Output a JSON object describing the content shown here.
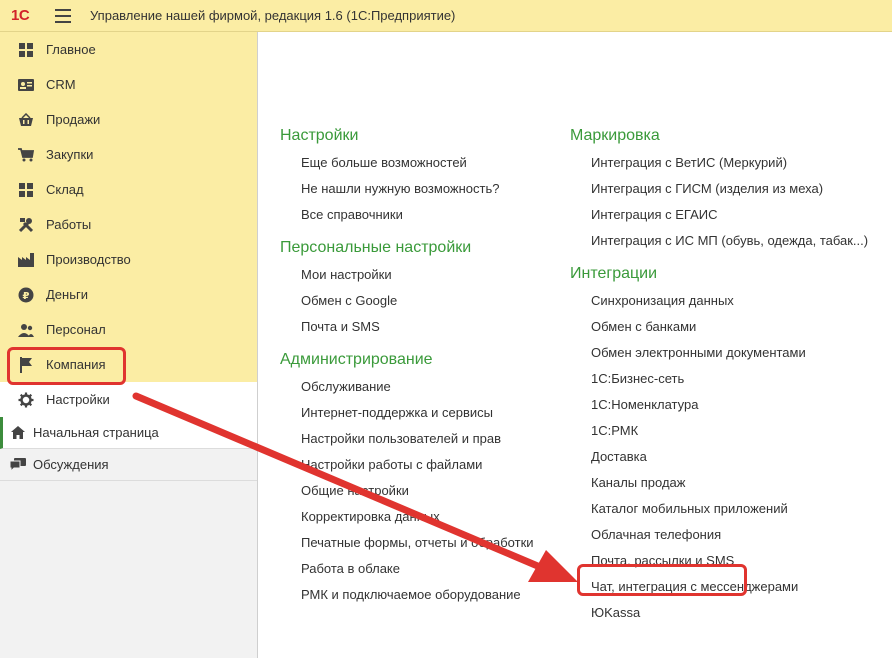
{
  "titlebar": {
    "logo": "1С",
    "title": "Управление нашей фирмой, редакция 1.6  (1С:Предприятие)"
  },
  "sidebar": {
    "sections": [
      {
        "label": "Главное",
        "icon": "grid-icon"
      },
      {
        "label": "CRM",
        "icon": "contacts-icon"
      },
      {
        "label": "Продажи",
        "icon": "basket-icon"
      },
      {
        "label": "Закупки",
        "icon": "cart-icon"
      },
      {
        "label": "Склад",
        "icon": "boxes-icon"
      },
      {
        "label": "Работы",
        "icon": "tools-icon"
      },
      {
        "label": "Производство",
        "icon": "factory-icon"
      },
      {
        "label": "Деньги",
        "icon": "ruble-coin-icon"
      },
      {
        "label": "Персонал",
        "icon": "people-icon"
      },
      {
        "label": "Компания",
        "icon": "flag-icon"
      },
      {
        "label": "Настройки",
        "icon": "gear-icon"
      }
    ],
    "bottom": [
      {
        "label": "Начальная страница",
        "icon": "home-icon"
      },
      {
        "label": "Обсуждения",
        "icon": "chat-icon"
      }
    ]
  },
  "main": {
    "left_groups": [
      {
        "title": "Настройки",
        "links": [
          "Еще больше возможностей",
          "Не нашли нужную возможность?",
          "Все справочники"
        ]
      },
      {
        "title": "Персональные настройки",
        "links": [
          "Мои настройки",
          "Обмен с Google",
          "Почта и SMS"
        ]
      },
      {
        "title": "Администрирование",
        "links": [
          "Обслуживание",
          "Интернет-поддержка и сервисы",
          "Настройки пользователей и прав",
          "Настройки работы с файлами",
          "Общие настройки",
          "Корректировка данных",
          "Печатные формы, отчеты и обработки",
          "Работа в облаке",
          "РМК и подключаемое оборудование"
        ]
      }
    ],
    "right_groups": [
      {
        "title": "Маркировка",
        "links": [
          "Интеграция с ВетИС (Меркурий)",
          "Интеграция с ГИСМ (изделия из меха)",
          "Интеграция с ЕГАИС",
          "Интеграция с ИС МП (обувь, одежда, табак...)"
        ]
      },
      {
        "title": "Интеграции",
        "links": [
          "Синхронизация данных",
          "Обмен с банками",
          "Обмен электронными документами",
          "1С:Бизнес-сеть",
          "1С:Номенклатура",
          "1С:РМК",
          "Доставка",
          "Каналы продаж",
          "Каталог мобильных приложений",
          "Облачная телефония",
          "Почта, рассылки и SMS",
          "Чат, интеграция с мессенджерами",
          "ЮKassa"
        ]
      }
    ]
  },
  "colors": {
    "section_bg": "#fbeda4",
    "group_title": "#3a9a3a",
    "highlight": "#e0342f"
  }
}
